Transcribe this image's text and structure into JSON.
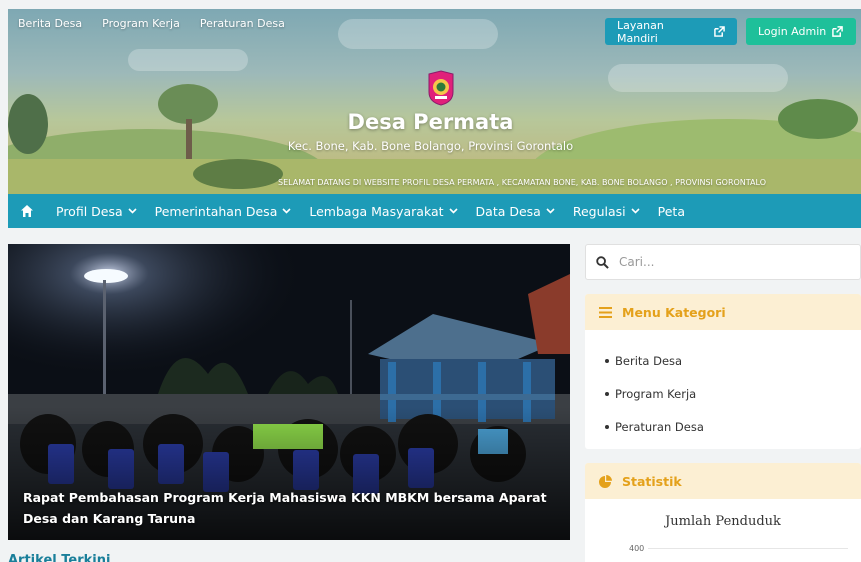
{
  "topbar": {
    "links": [
      "Berita Desa",
      "Program Kerja",
      "Peraturan Desa"
    ],
    "layanan_label": "Layanan Mandiri",
    "login_label": "Login Admin"
  },
  "hero": {
    "title": "Desa Permata",
    "subtitle": "Kec. Bone, Kab. Bone Bolango, Provinsi Gorontalo",
    "marquee": "SELAMAT DATANG DI WEBSITE PROFIL DESA PERMATA , KECAMATAN BONE, KAB. BONE BOLANGO , PROVINSI GORONTALO"
  },
  "mainnav": {
    "items": [
      {
        "label": "Profil Desa",
        "dropdown": true
      },
      {
        "label": "Pemerintahan Desa",
        "dropdown": true
      },
      {
        "label": "Lembaga Masyarakat",
        "dropdown": true
      },
      {
        "label": "Data Desa",
        "dropdown": true
      },
      {
        "label": "Regulasi",
        "dropdown": true
      },
      {
        "label": "Peta",
        "dropdown": false
      }
    ]
  },
  "feature": {
    "caption": "Rapat Pembahasan Program Kerja Mahasiswa KKN MBKM bersama Aparat Desa dan Karang Taruna"
  },
  "articles": {
    "heading": "Artikel Terkini"
  },
  "search": {
    "placeholder": "Cari..."
  },
  "menu_kategori": {
    "title": "Menu Kategori",
    "items": [
      "Berita Desa",
      "Program Kerja",
      "Peraturan Desa"
    ]
  },
  "statistik": {
    "title": "Statistik",
    "chart_title": "Jumlah Penduduk",
    "y_tick": "400"
  },
  "colors": {
    "primary": "#1d9bb7",
    "login": "#1ec09a",
    "accent": "#e4a11b",
    "card_header": "#fcefd3"
  }
}
